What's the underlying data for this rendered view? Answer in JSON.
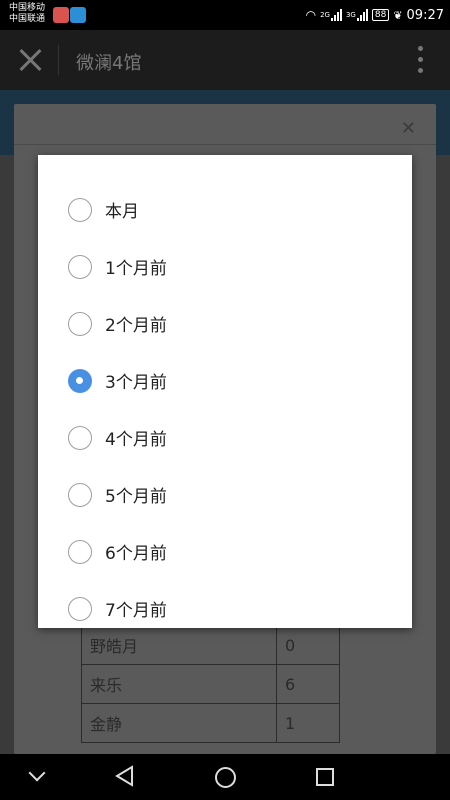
{
  "status_bar": {
    "carrier1": "中国移动",
    "carrier2": "中国联通",
    "battery": "88",
    "time": "09:27",
    "net1": "2G",
    "net2": "3G"
  },
  "app_bar": {
    "title": "微澜4馆"
  },
  "background_table": {
    "rows": [
      {
        "name": "野皓月",
        "value": "0"
      },
      {
        "name": "来乐",
        "value": "6"
      },
      {
        "name": "金静",
        "value": "1"
      }
    ]
  },
  "dialog": {
    "selected_index": 3,
    "accent_color": "#4a90e2",
    "options": [
      {
        "label": "本月"
      },
      {
        "label": "1个月前"
      },
      {
        "label": "2个月前"
      },
      {
        "label": "3个月前"
      },
      {
        "label": "4个月前"
      },
      {
        "label": "5个月前"
      },
      {
        "label": "6个月前"
      },
      {
        "label": "7个月前"
      }
    ]
  }
}
